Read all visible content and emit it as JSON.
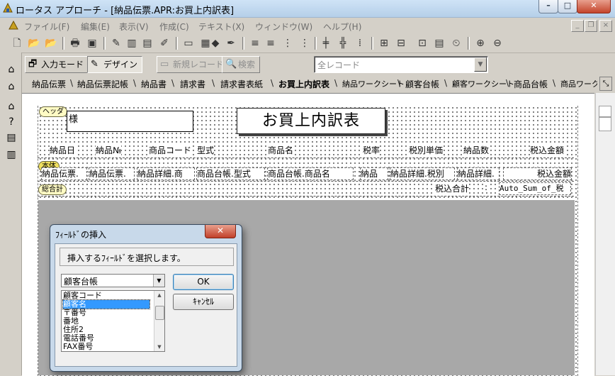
{
  "window": {
    "title": "ロータス アプローチ - [納品伝票.APR:お買上内訳表]"
  },
  "menu": [
    "ファイル(F)",
    "編集(E)",
    "表示(V)",
    "作成(C)",
    "テキスト(X)",
    "ウィンドウ(W)",
    "ヘルプ(H)"
  ],
  "modebar": {
    "input_mode": "入力モード",
    "design": "デザイン",
    "new_record": "新規レコード",
    "search": "検索",
    "record_filter": "全レコード"
  },
  "tabs": [
    "納品伝票",
    "納品伝票記帳",
    "納品書",
    "請求書",
    "請求書表紙",
    "お買上内訳表",
    "納品ワークシート",
    "顧客台帳",
    "顧客ワークシート",
    "商品台帳",
    "商品ワークシート"
  ],
  "report": {
    "title": "お買上内訳表",
    "honorific": "様",
    "band_header": "ヘッダ",
    "band_body": "本体",
    "band_total": "総合計",
    "columns": [
      "納品日",
      "納品№",
      "商品コード",
      "型式",
      "商品名",
      "税率",
      "税別単価",
      "納品数",
      "税込金額"
    ],
    "fields": [
      "納品伝票.",
      "納品伝票.",
      "納品詳細.商",
      "商品台帳.型式",
      "商品台帳.商品名",
      "納品",
      "納品詳細.税別",
      "納品詳細.",
      "税込金額"
    ],
    "total_label": "税込合計",
    "total_colon": ":",
    "total_field": "Auto_Sum_of_税"
  },
  "dialog": {
    "title": "ﾌｨｰﾙﾄﾞの挿入",
    "message": "挿入するﾌｨｰﾙﾄﾞを選択します。",
    "table_select": "顧客台帳",
    "ok": "OK",
    "cancel": "ｷｬﾝｾﾙ",
    "fields": [
      "顧客コード",
      "顧客名",
      "〒番号",
      "番地",
      "住所2",
      "電話番号",
      "FAX番号"
    ],
    "selected_index": 1
  },
  "colors": {
    "selection": "#3399ff",
    "canvas_bg": "#ffffff",
    "gray_pane": "#a8a8a8"
  }
}
